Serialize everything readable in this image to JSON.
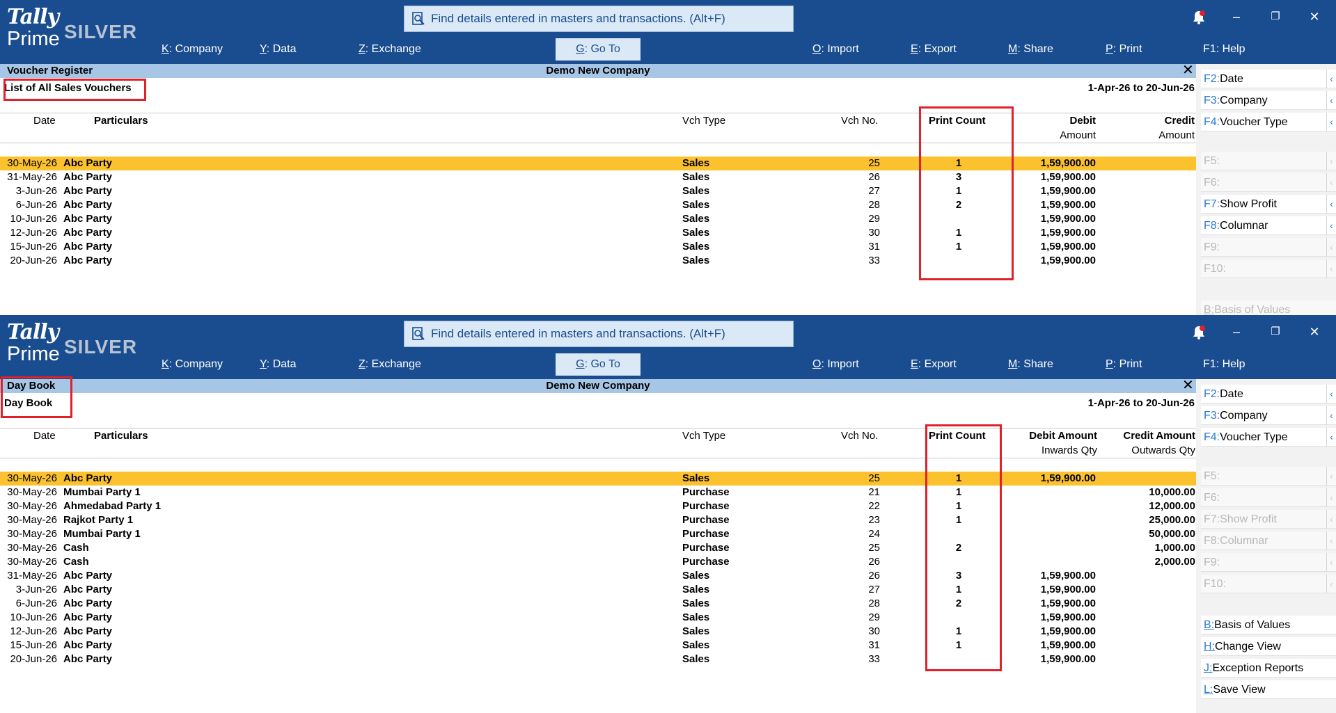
{
  "panes": [
    {
      "app": {
        "tally": "Tally",
        "prime": "Prime",
        "edition": "SILVER"
      },
      "search_placeholder": "Find details entered in masters and transactions. (Alt+F)",
      "menu": [
        {
          "key": "K",
          "label": "Company"
        },
        {
          "key": "Y",
          "label": "Data"
        },
        {
          "key": "Z",
          "label": "Exchange"
        },
        {
          "key": "G",
          "label": "Go To"
        },
        {
          "key": "O",
          "label": "Import"
        },
        {
          "key": "E",
          "label": "Export"
        },
        {
          "key": "M",
          "label": "Share"
        },
        {
          "key": "P",
          "label": "Print"
        },
        {
          "key": "F1",
          "label": "Help"
        }
      ],
      "report_name": "Voucher Register",
      "company": "Demo New Company",
      "report_title": "List of All Sales Vouchers",
      "period": "1-Apr-26 to 20-Jun-26",
      "columns": {
        "date": "Date",
        "particulars": "Particulars",
        "vch_type": "Vch Type",
        "vch_no": "Vch No.",
        "print_count": "Print Count",
        "debit": "Debit",
        "debit_sub": "Amount",
        "credit": "Credit",
        "credit_sub": "Amount"
      },
      "rows": [
        {
          "date": "30-May-26",
          "particulars": "Abc Party",
          "vch_type": "Sales",
          "vch_no": "25",
          "print_count": "1",
          "debit": "1,59,900.00",
          "credit": ""
        },
        {
          "date": "31-May-26",
          "particulars": "Abc Party",
          "vch_type": "Sales",
          "vch_no": "26",
          "print_count": "3",
          "debit": "1,59,900.00",
          "credit": ""
        },
        {
          "date": "3-Jun-26",
          "particulars": "Abc Party",
          "vch_type": "Sales",
          "vch_no": "27",
          "print_count": "1",
          "debit": "1,59,900.00",
          "credit": ""
        },
        {
          "date": "6-Jun-26",
          "particulars": "Abc Party",
          "vch_type": "Sales",
          "vch_no": "28",
          "print_count": "2",
          "debit": "1,59,900.00",
          "credit": ""
        },
        {
          "date": "10-Jun-26",
          "particulars": "Abc Party",
          "vch_type": "Sales",
          "vch_no": "29",
          "print_count": "",
          "debit": "1,59,900.00",
          "credit": ""
        },
        {
          "date": "12-Jun-26",
          "particulars": "Abc Party",
          "vch_type": "Sales",
          "vch_no": "30",
          "print_count": "1",
          "debit": "1,59,900.00",
          "credit": ""
        },
        {
          "date": "15-Jun-26",
          "particulars": "Abc Party",
          "vch_type": "Sales",
          "vch_no": "31",
          "print_count": "1",
          "debit": "1,59,900.00",
          "credit": ""
        },
        {
          "date": "20-Jun-26",
          "particulars": "Abc Party",
          "vch_type": "Sales",
          "vch_no": "33",
          "print_count": "",
          "debit": "1,59,900.00",
          "credit": ""
        }
      ],
      "side": [
        {
          "key": "F2",
          "label": "Date",
          "enabled": true
        },
        {
          "key": "F3",
          "label": "Company",
          "enabled": true
        },
        {
          "key": "F4",
          "label": "Voucher Type",
          "enabled": true
        },
        {
          "key": "F5",
          "label": "",
          "enabled": false
        },
        {
          "key": "F6",
          "label": "",
          "enabled": false
        },
        {
          "key": "F7",
          "label": "Show Profit",
          "enabled": true
        },
        {
          "key": "F8",
          "label": "Columnar",
          "enabled": true
        },
        {
          "key": "F9",
          "label": "",
          "enabled": false
        },
        {
          "key": "F10",
          "label": "",
          "enabled": false
        },
        {
          "key": "B",
          "label": "Basis of Values",
          "enabled": false
        }
      ]
    },
    {
      "app": {
        "tally": "Tally",
        "prime": "Prime",
        "edition": "SILVER"
      },
      "search_placeholder": "Find details entered in masters and transactions. (Alt+F)",
      "menu": [
        {
          "key": "K",
          "label": "Company"
        },
        {
          "key": "Y",
          "label": "Data"
        },
        {
          "key": "Z",
          "label": "Exchange"
        },
        {
          "key": "G",
          "label": "Go To"
        },
        {
          "key": "O",
          "label": "Import"
        },
        {
          "key": "E",
          "label": "Export"
        },
        {
          "key": "M",
          "label": "Share"
        },
        {
          "key": "P",
          "label": "Print"
        },
        {
          "key": "F1",
          "label": "Help"
        }
      ],
      "report_name": "Day Book",
      "company": "Demo New Company",
      "report_title": "Day Book",
      "period": "1-Apr-26 to 20-Jun-26",
      "columns": {
        "date": "Date",
        "particulars": "Particulars",
        "vch_type": "Vch Type",
        "vch_no": "Vch No.",
        "print_count": "Print Count",
        "debit": "Debit Amount",
        "debit_sub": "Inwards Qty",
        "credit": "Credit Amount",
        "credit_sub": "Outwards Qty"
      },
      "rows": [
        {
          "date": "30-May-26",
          "particulars": "Abc Party",
          "vch_type": "Sales",
          "vch_no": "25",
          "print_count": "1",
          "debit": "1,59,900.00",
          "credit": ""
        },
        {
          "date": "30-May-26",
          "particulars": "Mumbai Party 1",
          "vch_type": "Purchase",
          "vch_no": "21",
          "print_count": "1",
          "debit": "",
          "credit": "10,000.00"
        },
        {
          "date": "30-May-26",
          "particulars": "Ahmedabad Party 1",
          "vch_type": "Purchase",
          "vch_no": "22",
          "print_count": "1",
          "debit": "",
          "credit": "12,000.00"
        },
        {
          "date": "30-May-26",
          "particulars": "Rajkot Party 1",
          "vch_type": "Purchase",
          "vch_no": "23",
          "print_count": "1",
          "debit": "",
          "credit": "25,000.00"
        },
        {
          "date": "30-May-26",
          "particulars": "Mumbai Party 1",
          "vch_type": "Purchase",
          "vch_no": "24",
          "print_count": "",
          "debit": "",
          "credit": "50,000.00"
        },
        {
          "date": "30-May-26",
          "particulars": "Cash",
          "vch_type": "Purchase",
          "vch_no": "25",
          "print_count": "2",
          "debit": "",
          "credit": "1,000.00"
        },
        {
          "date": "30-May-26",
          "particulars": "Cash",
          "vch_type": "Purchase",
          "vch_no": "26",
          "print_count": "",
          "debit": "",
          "credit": "2,000.00"
        },
        {
          "date": "31-May-26",
          "particulars": "Abc Party",
          "vch_type": "Sales",
          "vch_no": "26",
          "print_count": "3",
          "debit": "1,59,900.00",
          "credit": ""
        },
        {
          "date": "3-Jun-26",
          "particulars": "Abc Party",
          "vch_type": "Sales",
          "vch_no": "27",
          "print_count": "1",
          "debit": "1,59,900.00",
          "credit": ""
        },
        {
          "date": "6-Jun-26",
          "particulars": "Abc Party",
          "vch_type": "Sales",
          "vch_no": "28",
          "print_count": "2",
          "debit": "1,59,900.00",
          "credit": ""
        },
        {
          "date": "10-Jun-26",
          "particulars": "Abc Party",
          "vch_type": "Sales",
          "vch_no": "29",
          "print_count": "",
          "debit": "1,59,900.00",
          "credit": ""
        },
        {
          "date": "12-Jun-26",
          "particulars": "Abc Party",
          "vch_type": "Sales",
          "vch_no": "30",
          "print_count": "1",
          "debit": "1,59,900.00",
          "credit": ""
        },
        {
          "date": "15-Jun-26",
          "particulars": "Abc Party",
          "vch_type": "Sales",
          "vch_no": "31",
          "print_count": "1",
          "debit": "1,59,900.00",
          "credit": ""
        },
        {
          "date": "20-Jun-26",
          "particulars": "Abc Party",
          "vch_type": "Sales",
          "vch_no": "33",
          "print_count": "",
          "debit": "1,59,900.00",
          "credit": ""
        }
      ],
      "side": [
        {
          "key": "F2",
          "label": "Date",
          "enabled": true
        },
        {
          "key": "F3",
          "label": "Company",
          "enabled": true
        },
        {
          "key": "F4",
          "label": "Voucher Type",
          "enabled": true
        },
        {
          "key": "F5",
          "label": "",
          "enabled": false
        },
        {
          "key": "F6",
          "label": "",
          "enabled": false
        },
        {
          "key": "F7",
          "label": "Show Profit",
          "enabled": false
        },
        {
          "key": "F8",
          "label": "Columnar",
          "enabled": false
        },
        {
          "key": "F9",
          "label": "",
          "enabled": false
        },
        {
          "key": "F10",
          "label": "",
          "enabled": false
        },
        {
          "key": "B",
          "label": "Basis of Values",
          "enabled": true
        },
        {
          "key": "H",
          "label": "Change View",
          "enabled": true
        },
        {
          "key": "J",
          "label": "Exception Reports",
          "enabled": true
        },
        {
          "key": "L",
          "label": "Save View",
          "enabled": true
        }
      ]
    }
  ],
  "window_controls": {
    "minimize": "–",
    "restore": "❐",
    "close": "✕"
  },
  "colors": {
    "header": "#1a4d8f",
    "subbar": "#a7c6e6",
    "selected_row": "#fcc22d",
    "highlight_box": "#e0202a",
    "fkey": "#2b7bd6"
  }
}
